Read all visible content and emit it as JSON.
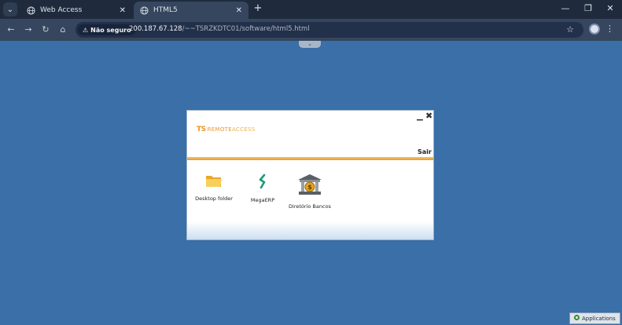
{
  "browser": {
    "tabs": [
      {
        "label": "Web Access"
      },
      {
        "label": "HTML5"
      }
    ],
    "security_label": "Não seguro",
    "url_host": "200.187.67.128",
    "url_path": "/~~TSRZKDTC01/software/html5.html"
  },
  "remote_access": {
    "logo_mark": "TS",
    "logo_text_plain": "REMOTE",
    "logo_text_accent": "ACCESS",
    "sair_label": "Sair",
    "apps": [
      {
        "label": "Desktop folder",
        "icon": "folder-icon"
      },
      {
        "label": "MegaERP",
        "icon": "megaerp-icon"
      },
      {
        "label": "Diretório Bancos",
        "icon": "bank-icon"
      }
    ]
  },
  "taskbar": {
    "applications_label": "Applications"
  },
  "colors": {
    "desktop_bg": "#3a6fa8",
    "brand_orange": "#e8972d"
  }
}
